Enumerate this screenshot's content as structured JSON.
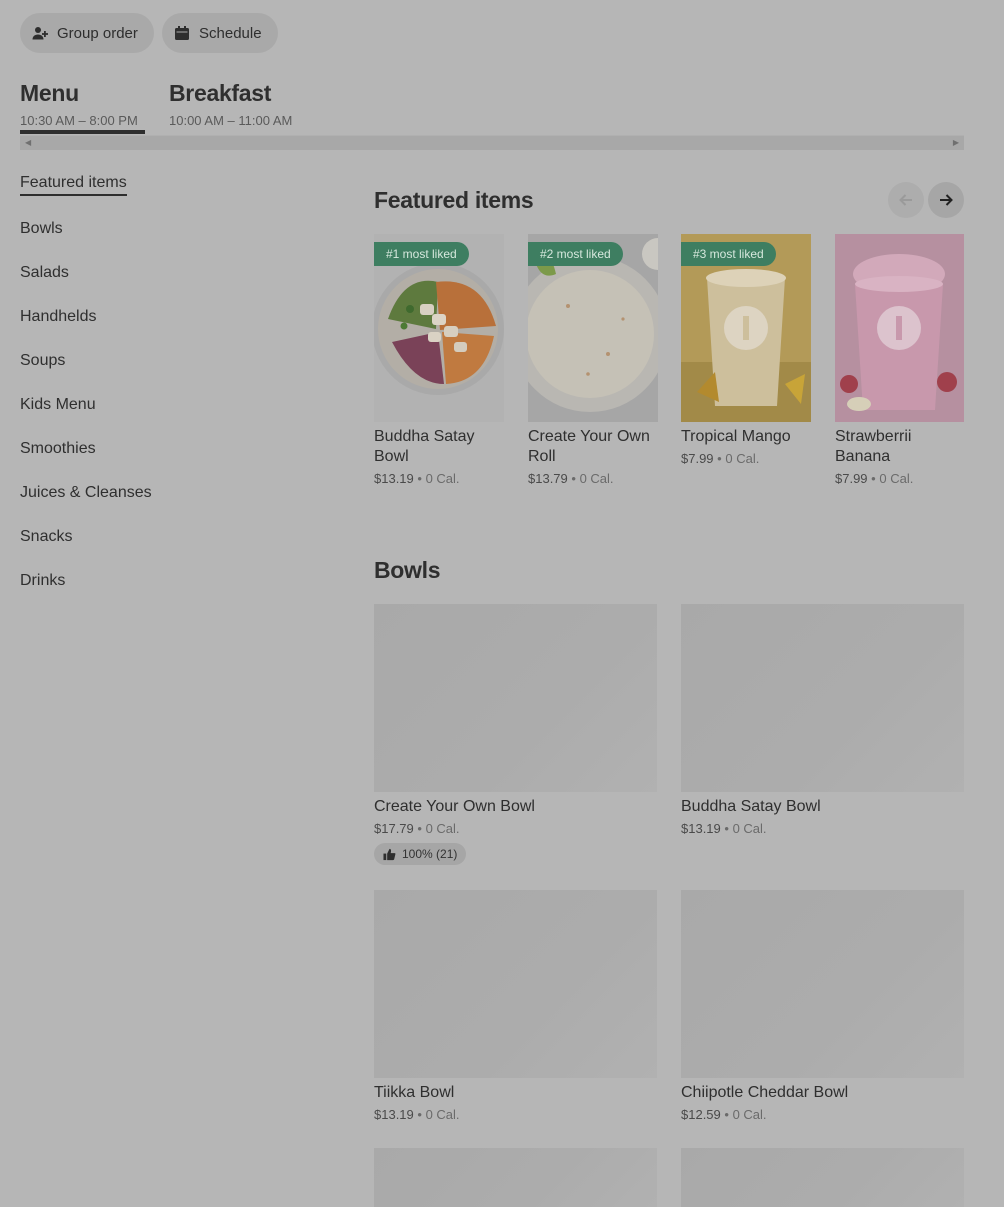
{
  "top_actions": {
    "group_order": "Group order",
    "schedule": "Schedule"
  },
  "menus": [
    {
      "name": "Menu",
      "hours": "10:30 AM – 8:00 PM",
      "active": true
    },
    {
      "name": "Breakfast",
      "hours": "10:00 AM – 11:00 AM",
      "active": false
    }
  ],
  "sidebar": {
    "items": [
      {
        "label": "Featured items",
        "active": true
      },
      {
        "label": "Bowls"
      },
      {
        "label": "Salads"
      },
      {
        "label": "Handhelds"
      },
      {
        "label": "Soups"
      },
      {
        "label": "Kids Menu"
      },
      {
        "label": "Smoothies"
      },
      {
        "label": "Juices & Cleanses"
      },
      {
        "label": "Snacks"
      },
      {
        "label": "Drinks"
      }
    ]
  },
  "featured": {
    "title": "Featured items",
    "items": [
      {
        "badge": "#1 most liked",
        "name": "Buddha Satay Bowl",
        "price": "$13.19",
        "calories": "0 Cal."
      },
      {
        "badge": "#2 most liked",
        "name": "Create Your Own Roll",
        "price": "$13.79",
        "calories": "0 Cal."
      },
      {
        "badge": "#3 most liked",
        "name": "Tropical Mango",
        "price": "$7.99",
        "calories": "0 Cal."
      },
      {
        "badge": "",
        "name": "Strawberrii Banana",
        "price": "$7.99",
        "calories": "0 Cal."
      }
    ]
  },
  "bowls": {
    "title": "Bowls",
    "items": [
      {
        "name": "Create Your Own Bowl",
        "price": "$17.79",
        "calories": "0 Cal.",
        "rating": "100% (21)"
      },
      {
        "name": "Buddha Satay Bowl",
        "price": "$13.19",
        "calories": "0 Cal."
      },
      {
        "name": "Tiikka Bowl",
        "price": "$13.19",
        "calories": "0 Cal."
      },
      {
        "name": "Chiipotle Cheddar Bowl",
        "price": "$12.59",
        "calories": "0 Cal."
      }
    ]
  },
  "separator": "•",
  "colors": {
    "badge": "#3e7e61",
    "overlay_gray": "#b6b6b6"
  }
}
